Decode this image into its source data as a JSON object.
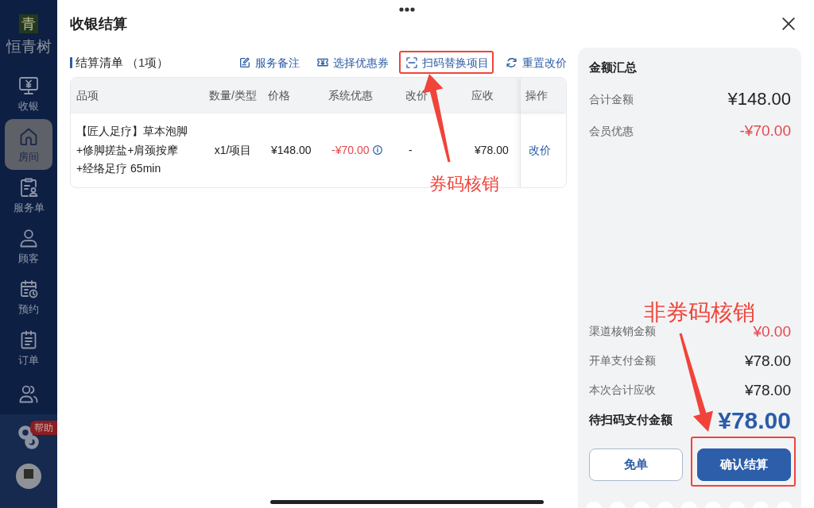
{
  "sidebar": {
    "logo": {
      "mark": "青",
      "name": "恒青树"
    },
    "items": [
      {
        "label": "收银",
        "selected": false
      },
      {
        "label": "房间",
        "selected": true
      },
      {
        "label": "服务单",
        "selected": false
      },
      {
        "label": "顾客",
        "selected": false
      },
      {
        "label": "预约",
        "selected": false
      },
      {
        "label": "订单",
        "selected": false
      },
      {
        "selected": false
      }
    ],
    "help": {
      "badge": "帮助"
    }
  },
  "dialog": {
    "title": "收银结算"
  },
  "settlement": {
    "title": "结算清单",
    "count": "（1项）",
    "actions": [
      {
        "label": "服务备注",
        "highlighted": false
      },
      {
        "label": "选择优惠券",
        "highlighted": false
      },
      {
        "label": "扫码替换项目",
        "highlighted": true
      },
      {
        "label": "重置改价",
        "highlighted": false
      }
    ]
  },
  "table": {
    "columns": [
      "品项",
      "数量/类型",
      "价格",
      "系统优惠",
      "改价",
      "应收",
      "操作"
    ],
    "rows": [
      {
        "item": "【匠人足疗】草本泡脚+修脚搓盐+肩颈按摩+经络足疗 65min",
        "quantity": "x1/项目",
        "price": "¥148.00",
        "system_discount": "-¥70.00",
        "price_change": "-",
        "receivable": "¥78.00",
        "action": "改价"
      }
    ]
  },
  "summary": {
    "title": "金额汇总",
    "top_lines": [
      {
        "label": "合计金额",
        "value": "¥148.00",
        "color": "#222222"
      },
      {
        "label": "会员优惠",
        "value": "-¥70.00",
        "color": "#e5484d"
      }
    ],
    "bottom_lines": [
      {
        "label": "渠道核销金额",
        "value": "¥0.00",
        "color": "#e5484d"
      },
      {
        "label": "开单支付金额",
        "value": "¥78.00",
        "color": "#222222"
      },
      {
        "label": "本次合计应收",
        "value": "¥78.00",
        "color": "#222222"
      }
    ],
    "total": {
      "label": "待扫码支付金额",
      "value": "¥78.00"
    },
    "buttons": [
      {
        "label": "免单",
        "kind": "outline",
        "highlighted": false
      },
      {
        "label": "确认结算",
        "kind": "primary",
        "highlighted": true
      }
    ]
  },
  "annotations": [
    {
      "text": "券码核销"
    },
    {
      "text": "非券码核销"
    }
  ]
}
